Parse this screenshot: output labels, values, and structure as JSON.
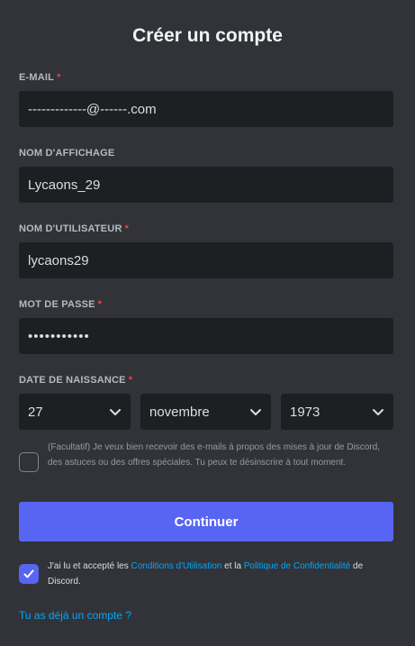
{
  "title": "Créer un compte",
  "required_mark": "*",
  "fields": {
    "email": {
      "label": "E-MAIL",
      "value": "-------------@------.com"
    },
    "display_name": {
      "label": "NOM D'AFFICHAGE",
      "value": "Lycaons_29"
    },
    "username": {
      "label": "NOM D'UTILISATEUR",
      "value": "lycaons29"
    },
    "password": {
      "label": "MOT DE PASSE",
      "value": "•••••••••••"
    }
  },
  "birthdate": {
    "label": "DATE DE NAISSANCE",
    "day": "27",
    "month": "novembre",
    "year": "1973"
  },
  "optin": {
    "checked": false,
    "text": "(Facultatif) Je veux bien recevoir des e-mails à propos des mises à jour de Discord, des astuces ou des offres spéciales. Tu peux te désinscrire à tout moment."
  },
  "continue_button": "Continuer",
  "terms": {
    "checked": true,
    "prefix": "J'ai lu et accepté les ",
    "tos_link": "Conditions d'Utilisation",
    "middle": " et la ",
    "privacy_link": "Politique de Confidentialité",
    "suffix": " de Discord."
  },
  "login_link": "Tu as déjà un compte ?",
  "icons": {
    "select_chevron": "chevron-down-icon",
    "terms_check": "checkmark-icon"
  },
  "colors": {
    "background": "#313338",
    "input_background": "#1e1f22",
    "accent": "#5865f2",
    "link": "#00a8fc",
    "required": "#f23f42"
  }
}
